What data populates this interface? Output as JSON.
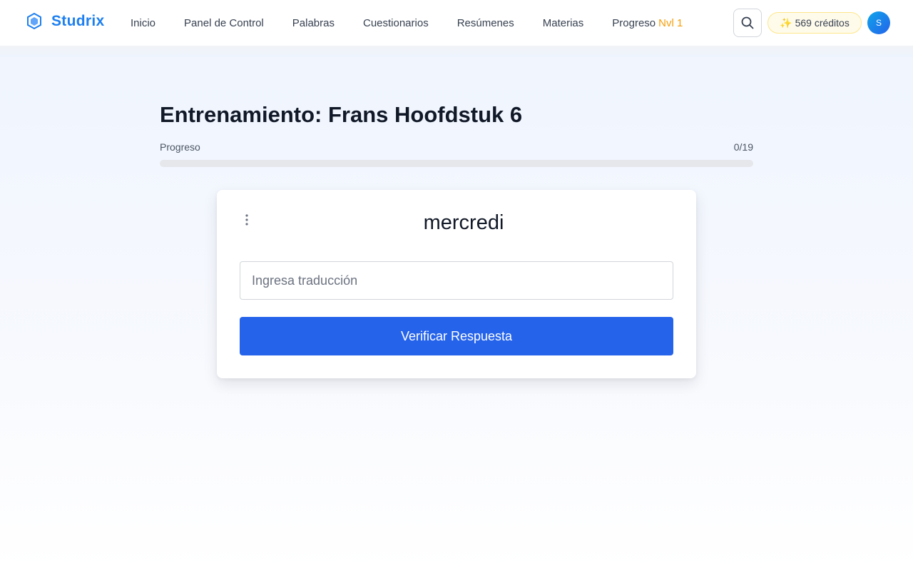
{
  "brand": {
    "name": "Studrix",
    "icon": "hexagon-logo-icon"
  },
  "nav": {
    "items": [
      "Inicio",
      "Panel de Control",
      "Palabras",
      "Cuestionarios",
      "Resúmenes",
      "Materias"
    ],
    "progress_label": "Progreso",
    "level": "Nvl 1"
  },
  "header": {
    "search_icon": "search-icon",
    "credits_emoji": "✨",
    "credits_text": "569 créditos",
    "avatar_initial": "S"
  },
  "page": {
    "title": "Entrenamiento: Frans Hoofdstuk 6"
  },
  "progress": {
    "label": "Progreso",
    "current": 0,
    "total": 19,
    "count_text": "0/19"
  },
  "card": {
    "word": "mercredi",
    "input_placeholder": "Ingresa traducción",
    "input_value": "",
    "verify_label": "Verificar Respuesta",
    "menu_icon": "kebab-menu-icon"
  },
  "colors": {
    "brand": "#1d7ff0",
    "primary": "#2563eb",
    "level": "#f59e0b",
    "credits_bg": "#fffbeb"
  }
}
